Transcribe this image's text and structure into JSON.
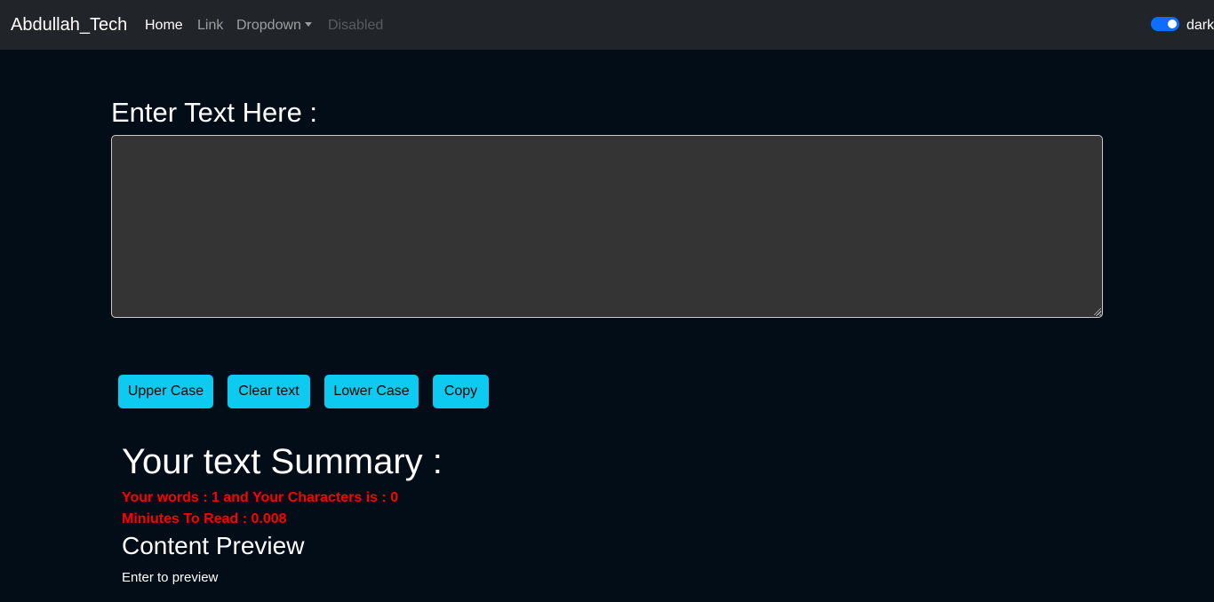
{
  "navbar": {
    "brand": "Abdullah_Tech",
    "links": {
      "home": "Home",
      "link": "Link",
      "dropdown": "Dropdown",
      "disabled": "Disabled"
    },
    "mode_switch": {
      "label": "dark",
      "checked": true
    }
  },
  "editor": {
    "heading": "Enter Text Here :",
    "value": ""
  },
  "buttons": {
    "upper": "Upper Case",
    "clear": "Clear text",
    "lower": "Lower Case",
    "copy": "Copy"
  },
  "summary": {
    "heading": "Your text Summary :",
    "words_line": "Your words : 1 and Your Characters is : 0",
    "read_line": "Miniutes To Read : 0.008"
  },
  "preview": {
    "heading": "Content Preview",
    "text": "Enter to preview"
  },
  "colors": {
    "navbar_bg": "#212529",
    "page_bg": "#020d18",
    "textarea_bg": "#343434",
    "button_bg": "#0dcaf0",
    "stats_text": "#ff0000",
    "switch_on": "#0d6efd"
  }
}
